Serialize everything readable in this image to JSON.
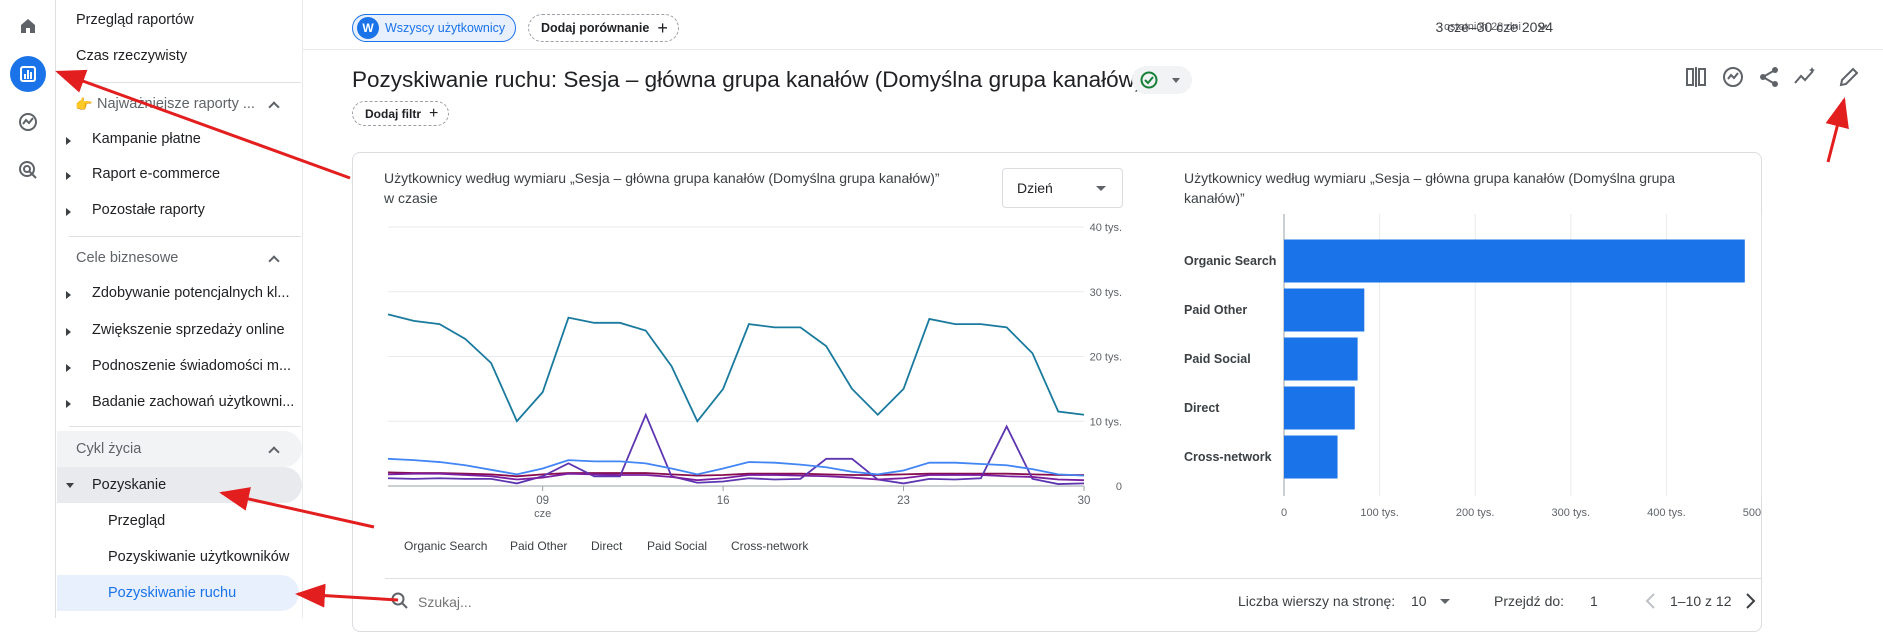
{
  "sidebar": {
    "top_items": [
      "Przegląd raportów",
      "Czas rzeczywisty"
    ],
    "group1": {
      "label": "Najważniejsze raporty ..."
    },
    "group1_items": [
      "Kampanie płatne",
      "Raport e-commerce",
      "Pozostałe raporty"
    ],
    "group2": {
      "label": "Cele biznesowe"
    },
    "group2_items": [
      "Zdobywanie potencjalnych kl...",
      "Zwiększenie sprzedaży online",
      "Podnoszenie świadomości m...",
      "Badanie zachowań użytkowni..."
    ],
    "group3": {
      "label": "Cykl życia"
    },
    "acquisition": {
      "label": "Pozyskanie"
    },
    "acq_items": [
      "Przegląd",
      "Pozyskiwanie użytkowników",
      "Pozyskiwanie ruchu"
    ]
  },
  "topbar": {
    "segment_avatar": "W",
    "segment_label": "Wszyscy użytkownicy",
    "compare_label": "Dodaj porównanie",
    "date_small": "ostatnich 28 dni",
    "date_range": "3 cze–30 cze 2024"
  },
  "page": {
    "title": "Pozyskiwanie ruchu: Sesja – główna grupa kanałów (Domyślna grupa kanałów)",
    "filter_label": "Dodaj filtr"
  },
  "line_card": {
    "title_line1": "Użytkownicy według wymiaru „Sesja – główna grupa kanałów (Domyślna grupa kanałów)”",
    "title_line2": "w czasie",
    "dropdown": "Dzień"
  },
  "bar_card": {
    "title_line1": "Użytkownicy według wymiaru „Sesja – główna grupa kanałów (Domyślna grupa",
    "title_line2": "kanałów)”"
  },
  "chart_data": [
    {
      "type": "line",
      "title": "Użytkownicy według wymiaru „Sesja – główna grupa kanałów (Domyślna grupa kanałów)” w czasie",
      "x": [
        3,
        4,
        5,
        6,
        7,
        8,
        9,
        10,
        11,
        12,
        13,
        14,
        15,
        16,
        17,
        18,
        19,
        20,
        21,
        22,
        23,
        24,
        25,
        26,
        27,
        28,
        29,
        30
      ],
      "x_ticks": [
        {
          "v": 9,
          "label": "09",
          "sub": "cze"
        },
        {
          "v": 16,
          "label": "16"
        },
        {
          "v": 23,
          "label": "23"
        },
        {
          "v": 30,
          "label": "30"
        }
      ],
      "y_ticks": [
        "0",
        "10 tys.",
        "20 tys.",
        "30 tys.",
        "40 tys."
      ],
      "ylim": [
        0,
        40000
      ],
      "series": [
        {
          "name": "Organic Search",
          "color": "#1a7a9e",
          "values": [
            26500,
            25500,
            25000,
            22700,
            19000,
            10000,
            14500,
            26000,
            25200,
            25200,
            24000,
            18500,
            10000,
            15000,
            25000,
            24500,
            24500,
            21600,
            15000,
            11000,
            15000,
            25800,
            25000,
            25000,
            24500,
            20500,
            11500,
            11000
          ]
        },
        {
          "name": "Paid Other",
          "color": "#4285f4",
          "values": [
            4200,
            4000,
            3700,
            3200,
            2500,
            1800,
            2700,
            4000,
            3800,
            3800,
            3500,
            2700,
            1800,
            2700,
            3700,
            3600,
            3300,
            2900,
            2200,
            1800,
            2400,
            3600,
            3600,
            3400,
            3200,
            2600,
            1800,
            1600
          ]
        },
        {
          "name": "Direct",
          "color": "#7b1fa2",
          "values": [
            1800,
            1900,
            1900,
            1700,
            1500,
            1000,
            1300,
            1900,
            1800,
            1700,
            1700,
            1400,
            900,
            1200,
            1700,
            1700,
            1600,
            1500,
            1300,
            1000,
            1200,
            1700,
            1700,
            1700,
            1500,
            1400,
            1000,
            900
          ]
        },
        {
          "name": "Paid Social",
          "color": "#5e35b1",
          "values": [
            1200,
            1100,
            1200,
            1100,
            1100,
            400,
            1500,
            3500,
            1500,
            1500,
            11000,
            1500,
            500,
            700,
            1200,
            1000,
            1100,
            4200,
            4200,
            1000,
            400,
            1100,
            1000,
            1200,
            9200,
            1100,
            300,
            400
          ]
        },
        {
          "name": "Cross-network",
          "color": "#880e4f",
          "values": [
            2100,
            2000,
            2000,
            1900,
            1800,
            1500,
            1800,
            2000,
            2000,
            2000,
            2000,
            1800,
            1600,
            1700,
            1900,
            1900,
            1900,
            1800,
            1700,
            1700,
            1800,
            1900,
            1900,
            1900,
            1900,
            1800,
            1700,
            1700
          ]
        }
      ]
    },
    {
      "type": "bar",
      "orientation": "horizontal",
      "title": "Użytkownicy według wymiaru „Sesja – główna grupa kanałów (Domyślna grupa kanałów)”",
      "categories": [
        "Organic Search",
        "Paid Other",
        "Paid Social",
        "Direct",
        "Cross-network"
      ],
      "values": [
        482000,
        84000,
        77000,
        74000,
        56000
      ],
      "x_ticks": [
        "0",
        "100 tys.",
        "200 tys.",
        "300 tys.",
        "400 tys.",
        "500 tys."
      ],
      "xlim": [
        0,
        500000
      ],
      "color": "#1a73e8"
    }
  ],
  "footer": {
    "search_placeholder": "Szukaj...",
    "rows_label": "Liczba wierszy na stronę:",
    "rows_value": "10",
    "goto_label": "Przejdź do:",
    "goto_value": "1",
    "page_info": "1–10 z 12"
  },
  "colors": {
    "accent": "#1a73e8",
    "annotation_arrow": "#e31e1e"
  }
}
